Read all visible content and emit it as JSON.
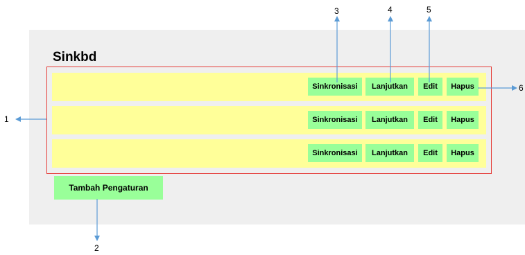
{
  "title": "Sinkbd",
  "rows": [
    {
      "sync": "Sinkronisasi",
      "next": "Lanjutkan",
      "edit": "Edit",
      "delete": "Hapus"
    },
    {
      "sync": "Sinkronisasi",
      "next": "Lanjutkan",
      "edit": "Edit",
      "delete": "Hapus"
    },
    {
      "sync": "Sinkronisasi",
      "next": "Lanjutkan",
      "edit": "Edit",
      "delete": "Hapus"
    }
  ],
  "add_button": "Tambah Pengaturan",
  "callouts": [
    "1",
    "2",
    "3",
    "4",
    "5",
    "6"
  ],
  "colors": {
    "panel": "#efefef",
    "row": "#ffff99",
    "button": "#99ff99",
    "list_border": "#e53935",
    "arrow": "#5b9bd5"
  }
}
